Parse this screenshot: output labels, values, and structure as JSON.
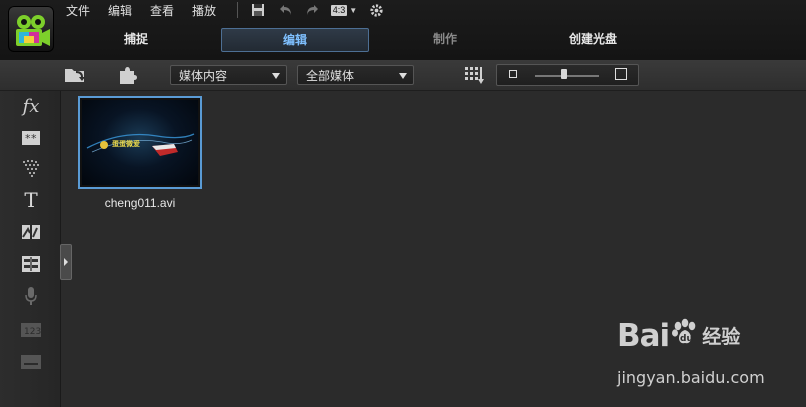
{
  "menu": [
    "文件",
    "编辑",
    "查看",
    "播放"
  ],
  "aspect": "4:3",
  "modes": {
    "capture": "捕捉",
    "edit": "编辑",
    "produce": "制作",
    "create_disc": "创建光盘"
  },
  "toolbar": {
    "media_dropdown": "媒体内容",
    "filter_dropdown": "全部媒体",
    "zoom_level": 0.45
  },
  "media": [
    {
      "filename": "cheng011.avi",
      "title_overlay": "蛋蛋微爱"
    }
  ],
  "watermark": {
    "brand": "Bai",
    "brand_suffix": "经验",
    "url": "jingyan.baidu.com"
  },
  "colors": {
    "accent": "#5a9bd5",
    "active_text": "#7fc0ff",
    "background": "#2b2b2b"
  },
  "icons": [
    "app-logo-icon",
    "save-icon",
    "undo-icon",
    "redo-icon",
    "settings-icon",
    "import-icon",
    "plugin-icon",
    "sort-grid-icon",
    "media-room-icon",
    "fx-icon",
    "transition-icon",
    "particle-icon",
    "title-icon",
    "pip-icon",
    "chapter-icon",
    "mic-icon",
    "subtitle-icon",
    "empty-frame-icon",
    "collapse-panel-icon"
  ]
}
